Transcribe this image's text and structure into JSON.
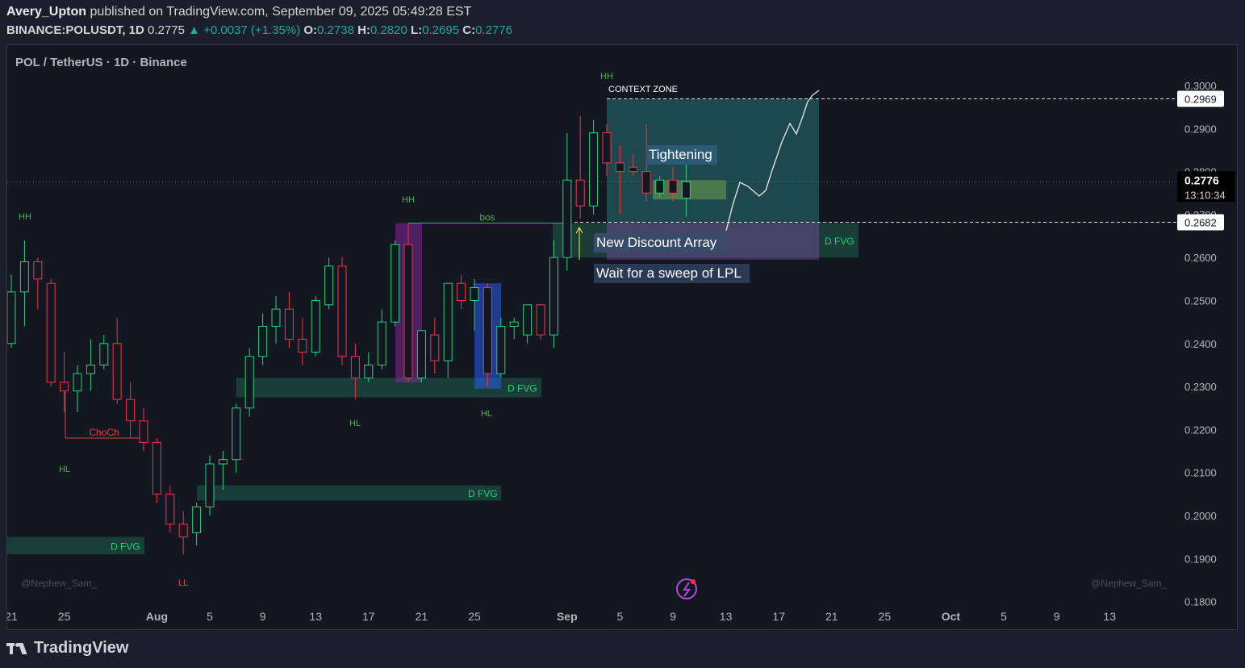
{
  "header": {
    "author": "Avery_Upton",
    "published_text": "published on TradingView.com, September 09, 2025 05:49:28 EST",
    "symbol": "BINANCE:POLUSDT, 1D",
    "last": "0.2775",
    "change": "▲ +0.0037 (+1.35%)",
    "o_label": "O:",
    "o_value": "0.2738",
    "h_label": "H:",
    "h_value": "0.2820",
    "l_label": "L:",
    "l_value": "0.2695",
    "c_label": "C:",
    "c_value": "0.2776"
  },
  "footer": {
    "brand": "TradingView"
  },
  "chart_data": {
    "type": "candlestick",
    "title": "POL / TetherUS · 1D · Binance",
    "ylim": [
      0.18,
      0.3
    ],
    "y_ticks": [
      "0.3000",
      "0.2900",
      "0.2800",
      "0.2700",
      "0.2600",
      "0.2500",
      "0.2400",
      "0.2300",
      "0.2200",
      "0.2100",
      "0.2000",
      "0.1900",
      "0.1800"
    ],
    "x_ticks": [
      {
        "label": "21",
        "i": 0
      },
      {
        "label": "25",
        "i": 4
      },
      {
        "label": "Aug",
        "i": 11
      },
      {
        "label": "5",
        "i": 15
      },
      {
        "label": "9",
        "i": 19
      },
      {
        "label": "13",
        "i": 23
      },
      {
        "label": "17",
        "i": 27
      },
      {
        "label": "21",
        "i": 31
      },
      {
        "label": "25",
        "i": 35
      },
      {
        "label": "Sep",
        "i": 42
      },
      {
        "label": "5",
        "i": 46
      },
      {
        "label": "9",
        "i": 50
      },
      {
        "label": "13",
        "i": 54
      },
      {
        "label": "17",
        "i": 58
      },
      {
        "label": "21",
        "i": 62
      },
      {
        "label": "25",
        "i": 66
      },
      {
        "label": "Oct",
        "i": 71
      },
      {
        "label": "5",
        "i": 75
      },
      {
        "label": "9",
        "i": 79
      },
      {
        "label": "13",
        "i": 83
      }
    ],
    "candles": [
      {
        "o": 0.24,
        "h": 0.256,
        "l": 0.239,
        "c": 0.252
      },
      {
        "o": 0.252,
        "h": 0.264,
        "l": 0.244,
        "c": 0.259
      },
      {
        "o": 0.259,
        "h": 0.26,
        "l": 0.248,
        "c": 0.255
      },
      {
        "o": 0.254,
        "h": 0.255,
        "l": 0.23,
        "c": 0.231
      },
      {
        "o": 0.231,
        "h": 0.238,
        "l": 0.224,
        "c": 0.229
      },
      {
        "o": 0.229,
        "h": 0.235,
        "l": 0.224,
        "c": 0.233
      },
      {
        "o": 0.233,
        "h": 0.241,
        "l": 0.229,
        "c": 0.235
      },
      {
        "o": 0.235,
        "h": 0.242,
        "l": 0.234,
        "c": 0.24
      },
      {
        "o": 0.24,
        "h": 0.246,
        "l": 0.226,
        "c": 0.227
      },
      {
        "o": 0.227,
        "h": 0.231,
        "l": 0.218,
        "c": 0.222
      },
      {
        "o": 0.222,
        "h": 0.225,
        "l": 0.215,
        "c": 0.217
      },
      {
        "o": 0.217,
        "h": 0.218,
        "l": 0.203,
        "c": 0.205
      },
      {
        "o": 0.205,
        "h": 0.207,
        "l": 0.196,
        "c": 0.198
      },
      {
        "o": 0.198,
        "h": 0.201,
        "l": 0.191,
        "c": 0.195
      },
      {
        "o": 0.196,
        "h": 0.203,
        "l": 0.193,
        "c": 0.202
      },
      {
        "o": 0.202,
        "h": 0.214,
        "l": 0.2,
        "c": 0.212
      },
      {
        "o": 0.212,
        "h": 0.215,
        "l": 0.206,
        "c": 0.213
      },
      {
        "o": 0.213,
        "h": 0.226,
        "l": 0.21,
        "c": 0.225
      },
      {
        "o": 0.225,
        "h": 0.239,
        "l": 0.223,
        "c": 0.237
      },
      {
        "o": 0.237,
        "h": 0.247,
        "l": 0.235,
        "c": 0.244
      },
      {
        "o": 0.244,
        "h": 0.251,
        "l": 0.24,
        "c": 0.248
      },
      {
        "o": 0.248,
        "h": 0.252,
        "l": 0.239,
        "c": 0.241
      },
      {
        "o": 0.241,
        "h": 0.246,
        "l": 0.235,
        "c": 0.238
      },
      {
        "o": 0.238,
        "h": 0.251,
        "l": 0.237,
        "c": 0.25
      },
      {
        "o": 0.249,
        "h": 0.26,
        "l": 0.248,
        "c": 0.258
      },
      {
        "o": 0.258,
        "h": 0.26,
        "l": 0.235,
        "c": 0.237
      },
      {
        "o": 0.237,
        "h": 0.24,
        "l": 0.227,
        "c": 0.232
      },
      {
        "o": 0.232,
        "h": 0.238,
        "l": 0.231,
        "c": 0.235
      },
      {
        "o": 0.235,
        "h": 0.248,
        "l": 0.234,
        "c": 0.245
      },
      {
        "o": 0.245,
        "h": 0.264,
        "l": 0.244,
        "c": 0.263
      },
      {
        "o": 0.263,
        "h": 0.268,
        "l": 0.231,
        "c": 0.232
      },
      {
        "o": 0.232,
        "h": 0.243,
        "l": 0.231,
        "c": 0.243
      },
      {
        "o": 0.242,
        "h": 0.246,
        "l": 0.233,
        "c": 0.236
      },
      {
        "o": 0.236,
        "h": 0.254,
        "l": 0.232,
        "c": 0.254
      },
      {
        "o": 0.254,
        "h": 0.256,
        "l": 0.248,
        "c": 0.25
      },
      {
        "o": 0.25,
        "h": 0.255,
        "l": 0.243,
        "c": 0.253
      },
      {
        "o": 0.253,
        "h": 0.254,
        "l": 0.23,
        "c": 0.233
      },
      {
        "o": 0.233,
        "h": 0.246,
        "l": 0.232,
        "c": 0.244
      },
      {
        "o": 0.244,
        "h": 0.246,
        "l": 0.241,
        "c": 0.245
      },
      {
        "o": 0.242,
        "h": 0.249,
        "l": 0.24,
        "c": 0.249
      },
      {
        "o": 0.249,
        "h": 0.249,
        "l": 0.241,
        "c": 0.242
      },
      {
        "o": 0.242,
        "h": 0.264,
        "l": 0.239,
        "c": 0.26
      },
      {
        "o": 0.26,
        "h": 0.289,
        "l": 0.257,
        "c": 0.278
      },
      {
        "o": 0.278,
        "h": 0.293,
        "l": 0.269,
        "c": 0.272
      },
      {
        "o": 0.272,
        "h": 0.292,
        "l": 0.27,
        "c": 0.289
      },
      {
        "o": 0.289,
        "h": 0.291,
        "l": 0.279,
        "c": 0.282
      },
      {
        "o": 0.282,
        "h": 0.286,
        "l": 0.27,
        "c": 0.28
      },
      {
        "o": 0.281,
        "h": 0.284,
        "l": 0.279,
        "c": 0.28
      },
      {
        "o": 0.28,
        "h": 0.291,
        "l": 0.273,
        "c": 0.275
      },
      {
        "o": 0.275,
        "h": 0.279,
        "l": 0.274,
        "c": 0.278
      },
      {
        "o": 0.278,
        "h": 0.281,
        "l": 0.273,
        "c": 0.275
      },
      {
        "o": 0.2738,
        "h": 0.282,
        "l": 0.2695,
        "c": 0.2776
      }
    ],
    "annotations": {
      "context_zone": "CONTEXT ZONE",
      "tightening": "Tightening",
      "discount": "New Discount Array",
      "sweep": "Wait for a sweep of LPL",
      "bos": "bos",
      "choch": "ChoCh",
      "dfvg": "D FVG",
      "hh": "HH",
      "hl": "HL",
      "ll": "LL",
      "watermark": "@Nephew_Sam_"
    },
    "price_labels": {
      "top": "0.2969",
      "current": "0.2776",
      "countdown": "13:10:34",
      "bottom": "0.2682"
    },
    "colors": {
      "up": "#26d07c",
      "down": "#f23645",
      "bg": "#131722",
      "zone": "#2a8c8c",
      "discount": "#7a4fa0",
      "fvg": "#1f5c48"
    }
  }
}
